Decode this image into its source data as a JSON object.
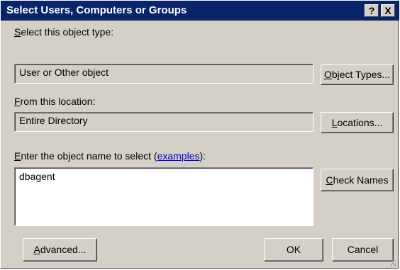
{
  "window": {
    "title": "Select Users, Computers or Groups",
    "help_button": "?",
    "close_button": "X"
  },
  "object_type": {
    "label_prefix": "",
    "label_accel": "S",
    "label_rest": "elect this object type:",
    "value": "User or Other object",
    "button_accel": "O",
    "button_rest": "bject Types..."
  },
  "location": {
    "label_accel": "F",
    "label_rest": "rom this location:",
    "value": "Entire Directory",
    "button_accel": "L",
    "button_rest": "ocations..."
  },
  "object_name": {
    "label_accel": "E",
    "label_rest": "nter the object name to select (",
    "link_text": "examples",
    "label_end": "):",
    "value": "dbagent",
    "check_button_accel": "C",
    "check_button_rest": "heck Names"
  },
  "footer": {
    "advanced_accel": "A",
    "advanced_rest": "dvanced...",
    "ok_label": "OK",
    "cancel_label": "Cancel"
  }
}
